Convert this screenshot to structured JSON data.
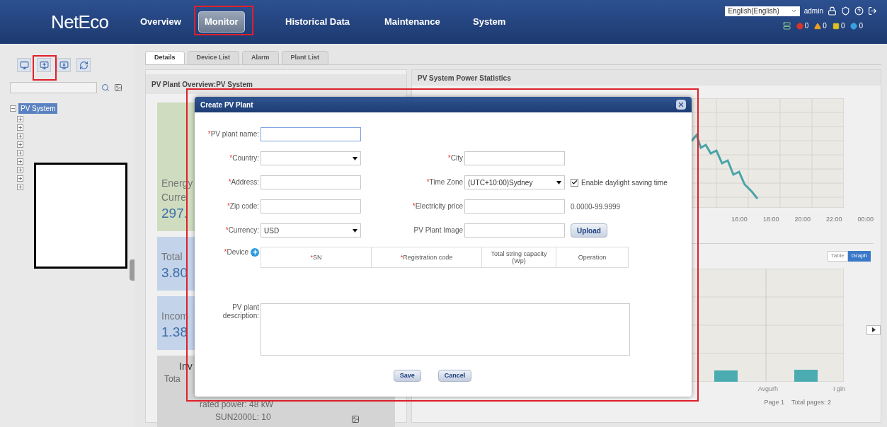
{
  "header": {
    "logo": "NetEco",
    "nav": [
      {
        "label": "Overview",
        "selected": false
      },
      {
        "label": "Monitor",
        "selected": true,
        "highlighted": true
      },
      {
        "label": "Historical Data",
        "selected": false
      },
      {
        "label": "Maintenance",
        "selected": false
      },
      {
        "label": "System",
        "selected": false
      }
    ],
    "language": "English(English)",
    "user": "admin",
    "alarms": [
      {
        "kind": "critical",
        "color": "#d9342b",
        "count": "0"
      },
      {
        "kind": "major",
        "color": "#f0a020",
        "count": "0"
      },
      {
        "kind": "minor",
        "color": "#e0c020",
        "count": "0"
      },
      {
        "kind": "warning",
        "color": "#3aa0e0",
        "count": "0"
      }
    ]
  },
  "sidebar": {
    "tools": [
      {
        "kind": "monitor"
      },
      {
        "kind": "add",
        "highlighted": true
      },
      {
        "kind": "remove"
      },
      {
        "kind": "refresh"
      }
    ],
    "tree": [
      {
        "label": "PV System",
        "selected": true,
        "expanded": true,
        "children": [
          {
            "expanded": false
          },
          {
            "expanded": false
          },
          {
            "expanded": false
          },
          {
            "expanded": false
          },
          {
            "expanded": false
          },
          {
            "expanded": false
          },
          {
            "expanded": false
          },
          {
            "expanded": false
          },
          {
            "expanded": false
          }
        ]
      }
    ]
  },
  "tabs": [
    {
      "label": "Details",
      "selected": true
    },
    {
      "label": "Device List",
      "selected": false
    },
    {
      "label": "Alarm",
      "selected": false
    },
    {
      "label": "Plant List",
      "selected": false
    }
  ],
  "overview": {
    "title": "PV Plant Overview:PV System",
    "cards": [
      {
        "kind": "energy",
        "lines": [
          "Energy",
          "Curre"
        ],
        "value": "297."
      },
      {
        "kind": "power",
        "lines": [
          "Total"
        ],
        "value": "3.80"
      },
      {
        "kind": "income",
        "lines": [
          "Incom"
        ],
        "value": "1.38"
      },
      {
        "kind": "inverter",
        "lines": [
          "Inv",
          "Tota",
          "rated power:  48 kW",
          "SUN2000L:  10"
        ]
      }
    ]
  },
  "statistics": {
    "title": "PV System Power Statistics",
    "x_ticks": [
      "16:00",
      "18:00",
      "20:00",
      "22:00",
      "00:00"
    ],
    "view_toggle": [
      {
        "label": "Table",
        "selected": false
      },
      {
        "label": "Graph",
        "selected": true
      }
    ],
    "bar_labels": [
      "Avgurh",
      "I gin"
    ],
    "pager": [
      "Page 1",
      "Total pages: 2"
    ]
  },
  "dialog": {
    "title": "Create PV Plant",
    "highlighted": true,
    "rows": [
      {
        "left": {
          "mark": "*",
          "label": "PV plant name:",
          "kind": "text",
          "focused": true
        }
      },
      {
        "left": {
          "mark": "*",
          "label": "Country:",
          "kind": "select"
        },
        "right": {
          "mark": "*",
          "label": "City",
          "kind": "text"
        }
      },
      {
        "left": {
          "mark": "*",
          "label": "Address:",
          "kind": "text"
        },
        "right": {
          "mark": "*",
          "label": "Time Zone",
          "kind": "select",
          "value": "(UTC+10:00)Sydney",
          "checkbox": {
            "label": "Enable daylight saving time",
            "checked": true
          }
        }
      },
      {
        "left": {
          "mark": "*",
          "label": "Zip code:",
          "kind": "text"
        },
        "right": {
          "mark": "*",
          "label": "Electricity price",
          "kind": "text",
          "hint": "0.0000-99.9999"
        }
      },
      {
        "left": {
          "mark": "*",
          "label": "Currency:",
          "kind": "select",
          "value": "USD"
        },
        "right": {
          "label": "PV Plant Image",
          "kind": "text",
          "button": "Upload"
        }
      }
    ],
    "device": {
      "mark": "*",
      "label": "Device",
      "columns": [
        {
          "mark": "*",
          "label": "SN"
        },
        {
          "mark": "*",
          "label": "Registration code"
        },
        {
          "label": "Total string capacity (Wp)"
        },
        {
          "label": "Operation"
        }
      ]
    },
    "description": {
      "label": "PV plant description:"
    },
    "buttons": [
      "Save",
      "Cancel"
    ]
  }
}
